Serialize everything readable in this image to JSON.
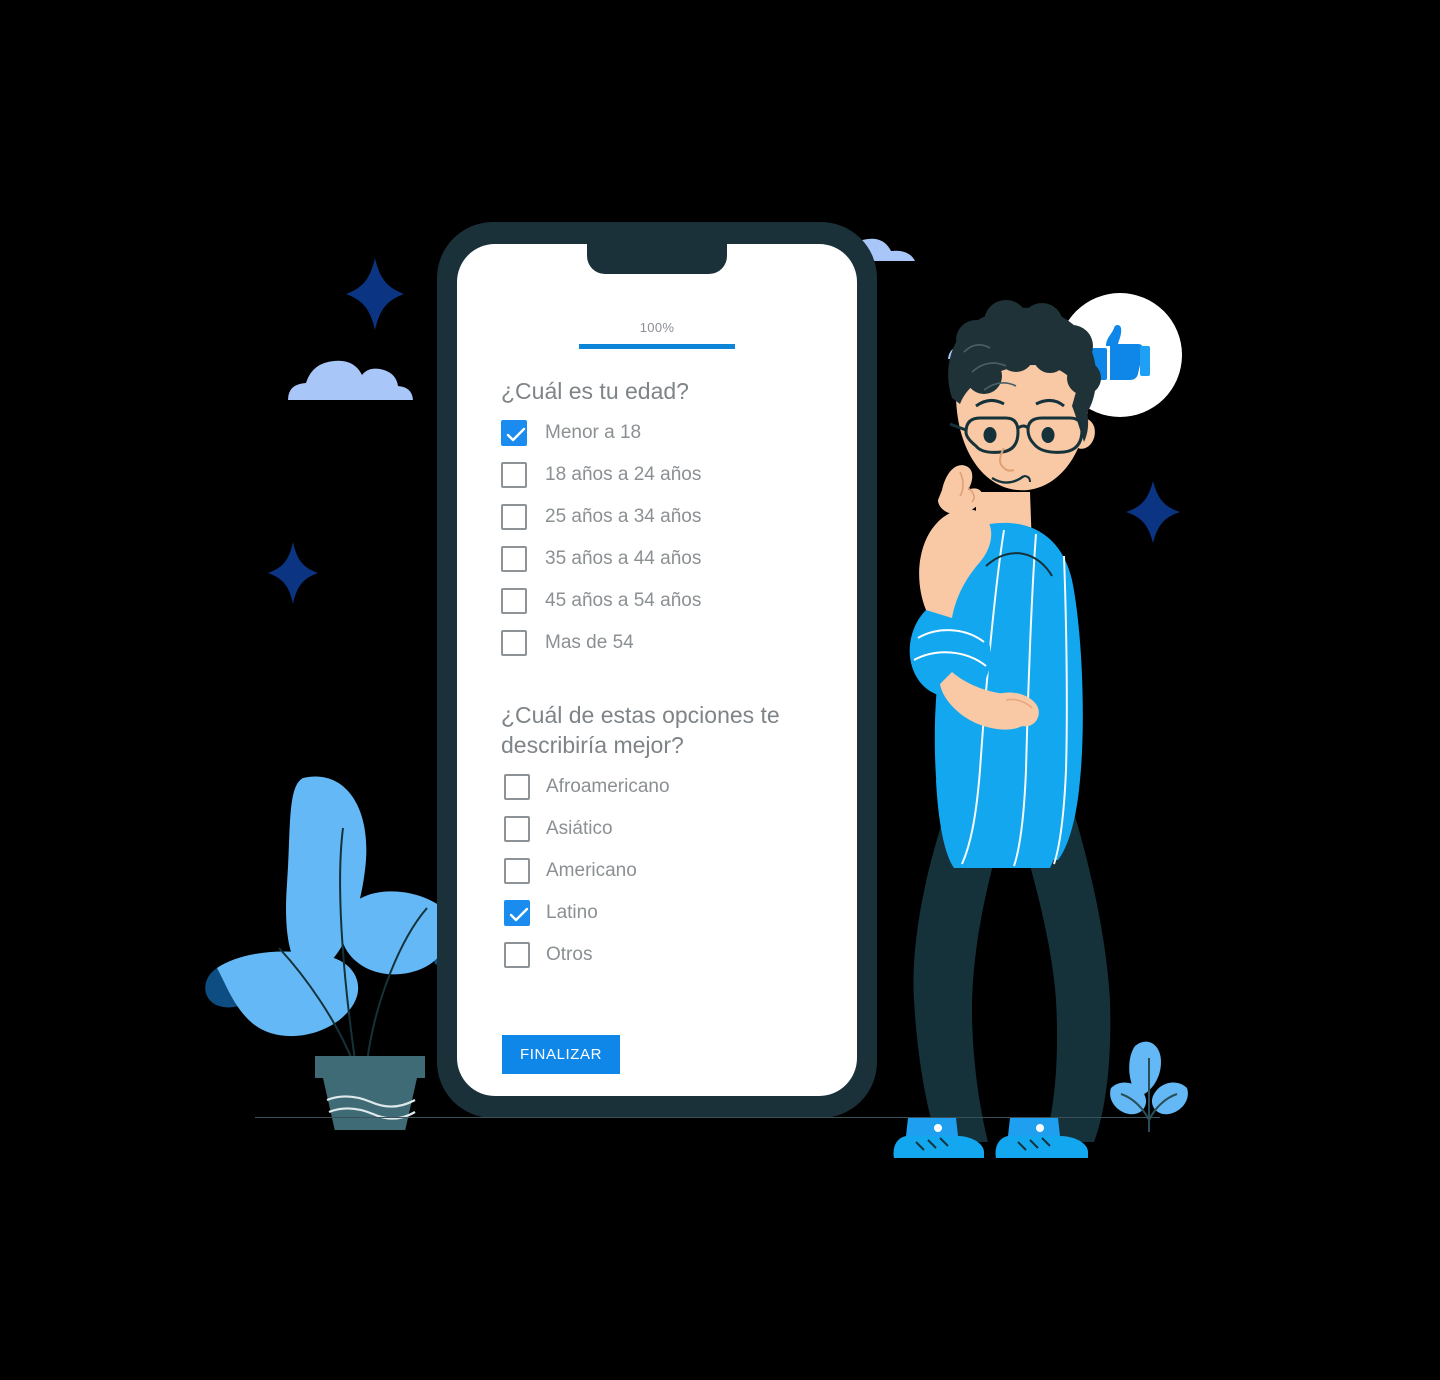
{
  "progress": {
    "label": "100%",
    "percent": 100
  },
  "questions": [
    {
      "title": "¿Cuál es tu edad?",
      "options": [
        {
          "label": "Menor a 18",
          "checked": true
        },
        {
          "label": "18 años a 24 años",
          "checked": false
        },
        {
          "label": "25 años a 34 años",
          "checked": false
        },
        {
          "label": "35 años a 44 años",
          "checked": false
        },
        {
          "label": "45 años a 54 años",
          "checked": false
        },
        {
          "label": "Mas de 54",
          "checked": false
        }
      ]
    },
    {
      "title": "¿Cuál de estas opciones te describiría mejor?",
      "options": [
        {
          "label": "Afroamericano",
          "checked": false
        },
        {
          "label": "Asiático",
          "checked": false
        },
        {
          "label": "Americano",
          "checked": false
        },
        {
          "label": "Latino",
          "checked": true
        },
        {
          "label": "Otros",
          "checked": false
        }
      ]
    }
  ],
  "submit": {
    "label": "FINALIZAR"
  },
  "icons": {
    "check": "check-icon",
    "thumbs_up": "thumbs-up-icon"
  },
  "colors": {
    "accent": "#0d86d9",
    "checkbox_checked": "#1a8cf0",
    "button": "#0f87e8",
    "phone_frame": "#1b3139",
    "text_muted": "#8b9093",
    "heading": "#7e8487",
    "cloud": "#a8c6f7",
    "star": "#0b3582",
    "leaf_light": "#63b8f5",
    "leaf_dark": "#0d4d82",
    "pot": "#3e6b75",
    "skin": "#f8c9a4",
    "hair": "#1f3238",
    "shirt": "#13a7ef",
    "pants": "#15323a"
  }
}
